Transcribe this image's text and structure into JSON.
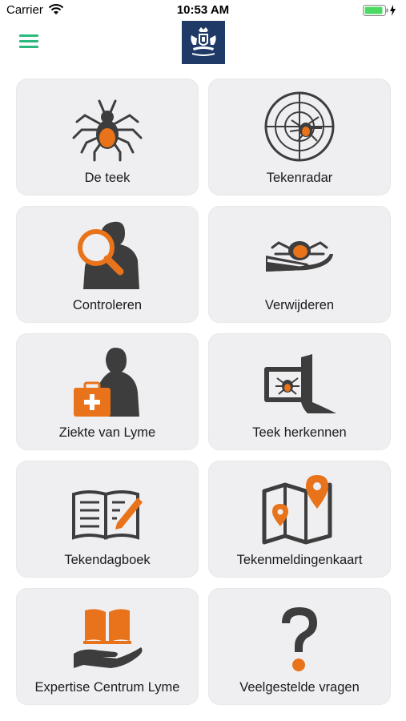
{
  "status_bar": {
    "carrier": "Carrier",
    "time": "10:53 AM"
  },
  "nav": {
    "menu_icon": "hamburger-menu-icon",
    "logo_icon": "rijksoverheid-coat-of-arms-icon"
  },
  "colors": {
    "accent_green": "#2db87d",
    "tile_bg": "#efeff2",
    "icon_orange": "#e8731a",
    "icon_dark": "#3d3d3d",
    "logo_blue": "#1f3a67"
  },
  "tiles": [
    {
      "label": "De teek",
      "icon": "tick-icon"
    },
    {
      "label": "Tekenradar",
      "icon": "radar-tick-icon"
    },
    {
      "label": "Controleren",
      "icon": "magnifier-body-icon"
    },
    {
      "label": "Verwijderen",
      "icon": "tick-removal-icon"
    },
    {
      "label": "Ziekte van Lyme",
      "icon": "medical-kit-person-icon"
    },
    {
      "label": "Teek herkennen",
      "icon": "photo-tick-hand-icon"
    },
    {
      "label": "Tekendagboek",
      "icon": "diary-pencil-icon"
    },
    {
      "label": "Tekenmeldingenkaart",
      "icon": "map-pins-icon"
    },
    {
      "label": "Expertise Centrum Lyme",
      "icon": "hand-book-icon"
    },
    {
      "label": "Veelgestelde vragen",
      "icon": "question-mark-icon"
    }
  ]
}
